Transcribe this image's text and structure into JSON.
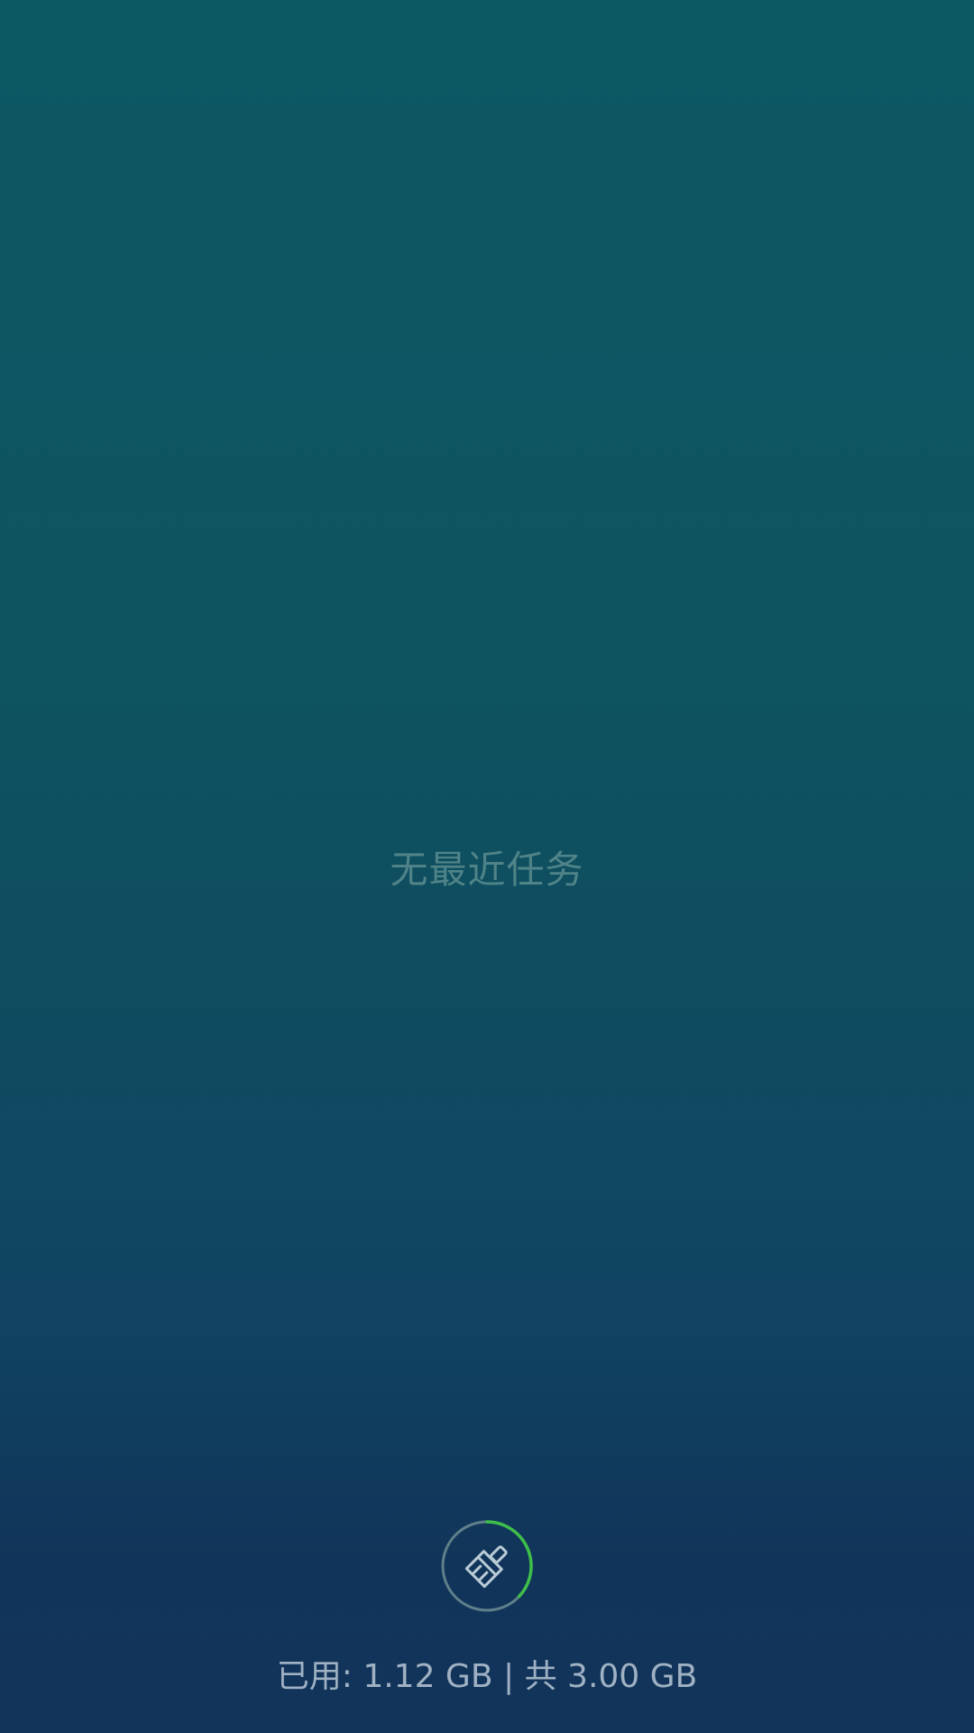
{
  "recents": {
    "empty_message": "无最近任务"
  },
  "memory": {
    "used_label": "已用:",
    "used_value": "1.12 GB",
    "separator": "|",
    "total_label": "共",
    "total_value": "3.00 GB",
    "usage_ratio": 0.37
  },
  "clean_button": {
    "icon": "broom-icon",
    "ring_color": "#5f7f8a",
    "progress_color": "#3fbf4a"
  }
}
